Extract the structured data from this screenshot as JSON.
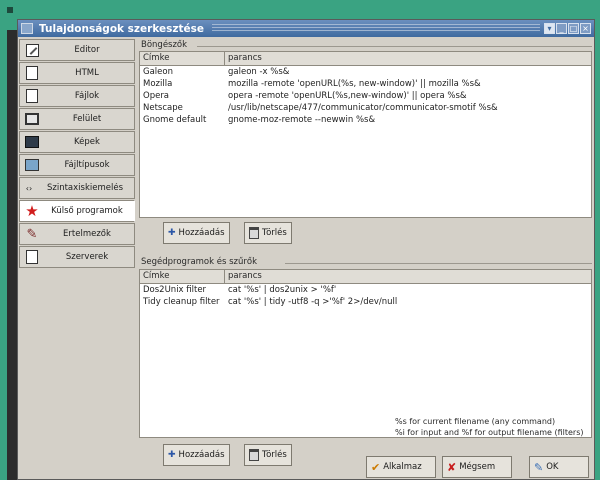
{
  "window": {
    "title": "Tulajdonságok szerkesztése",
    "controls": [
      "pin",
      "minimize",
      "maximize",
      "close"
    ]
  },
  "sidebar": {
    "items": [
      {
        "label": "Editor",
        "icon": "pencil-icon"
      },
      {
        "label": "HTML",
        "icon": "html-page-icon"
      },
      {
        "label": "Fájlok",
        "icon": "file-icon"
      },
      {
        "label": "Felület",
        "icon": "interface-icon"
      },
      {
        "label": "Képek",
        "icon": "image-icon"
      },
      {
        "label": "Fájltípusok",
        "icon": "filetypes-icon"
      },
      {
        "label": "Szintaxiskiemelés",
        "icon": "syntax-icon"
      },
      {
        "label": "Külső programok",
        "icon": "star-icon"
      },
      {
        "label": "Értelmezők",
        "icon": "interpreter-icon"
      },
      {
        "label": "Szerverek",
        "icon": "server-icon"
      }
    ],
    "active_index": 7
  },
  "browsers": {
    "group_label": "Böngészők",
    "columns": [
      "Címke",
      "parancs"
    ],
    "rows": [
      [
        "Galeon",
        "galeon -x %s&"
      ],
      [
        "Mozilla",
        "mozilla -remote 'openURL(%s, new-window)' || mozilla %s&"
      ],
      [
        "Opera",
        "opera -remote 'openURL(%s,new-window)' || opera %s&"
      ],
      [
        "Netscape",
        "/usr/lib/netscape/477/communicator/communicator-smotif %s&"
      ],
      [
        "Gnome default",
        "gnome-moz-remote --newwin %s&"
      ]
    ],
    "add_label": "Hozzáadás",
    "delete_label": "Törlés"
  },
  "filters": {
    "group_label": "Segédprogramok és szűrők",
    "columns": [
      "Címke",
      "parancs"
    ],
    "rows": [
      [
        "Dos2Unix filter",
        "cat '%s' | dos2unix > '%f'"
      ],
      [
        "Tidy cleanup filter",
        "cat '%s' | tidy -utf8 -q >'%f' 2>/dev/null"
      ]
    ],
    "hint_line1": "%s for current filename (any command)",
    "hint_line2": "%i for input and %f for output filename (filters)",
    "add_label": "Hozzáadás",
    "delete_label": "Törlés"
  },
  "footer": {
    "apply_label": "Alkalmaz",
    "cancel_label": "Mégsem",
    "ok_label": "OK"
  }
}
